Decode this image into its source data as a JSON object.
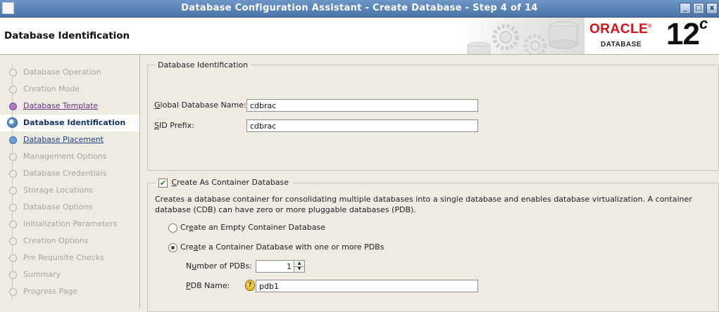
{
  "window": {
    "title": "Database Configuration Assistant - Create Database - Step 4 of 14",
    "controls": [
      "_",
      "□",
      "x"
    ]
  },
  "header": {
    "page_title": "Database Identification",
    "brand": {
      "oracle": "ORACLE",
      "registered": "®",
      "database": "DATABASE",
      "version": "12",
      "version_suffix": "c"
    }
  },
  "sidebar": {
    "steps": [
      {
        "label": "Database Operation",
        "state": "disabled"
      },
      {
        "label": "Creation Mode",
        "state": "disabled"
      },
      {
        "label": "Database Template",
        "state": "visited"
      },
      {
        "label": "Database Identification",
        "state": "current"
      },
      {
        "label": "Database Placement",
        "state": "link"
      },
      {
        "label": "Management Options",
        "state": "disabled"
      },
      {
        "label": "Database Credentials",
        "state": "disabled"
      },
      {
        "label": "Storage Locations",
        "state": "disabled"
      },
      {
        "label": "Database Options",
        "state": "disabled"
      },
      {
        "label": "Initialization Parameters",
        "state": "disabled"
      },
      {
        "label": "Creation Options",
        "state": "disabled"
      },
      {
        "label": "Pre Requisite Checks",
        "state": "disabled"
      },
      {
        "label": "Summary",
        "state": "disabled"
      },
      {
        "label": "Progress Page",
        "state": "disabled"
      }
    ]
  },
  "identification": {
    "group_title": "Database Identification",
    "global_name_label_mnemonic": "G",
    "global_name_label_rest": "lobal Database Name:",
    "global_name_value": "cdbrac",
    "sid_label_mnemonic": "S",
    "sid_label_rest": "ID Prefix:",
    "sid_value": "cdbrac"
  },
  "container": {
    "checkbox_checked": true,
    "checkbox_label_mnemonic": "C",
    "checkbox_label_rest": "reate As Container Database",
    "description_line1": "Creates a database container for consolidating multiple databases into a single database and enables database virtualization. A container",
    "description_line2": "database (CDB) can have zero or more pluggable databases (PDB).",
    "option_empty_pre": "Cr",
    "option_empty_mnemonic": "e",
    "option_empty_post": "ate an Empty Container Database",
    "option_empty_selected": false,
    "option_pdbs_pre": "Cre",
    "option_pdbs_mnemonic": "a",
    "option_pdbs_post": "te a Container Database with one or more PDBs",
    "option_pdbs_selected": true,
    "num_pdbs_label_pre": "N",
    "num_pdbs_label_mnemonic": "u",
    "num_pdbs_label_post": "mber of PDBs:",
    "num_pdbs_value": "1",
    "pdb_name_label_mnemonic": "P",
    "pdb_name_label_rest": "DB Name:",
    "pdb_name_value": "pdb1"
  }
}
